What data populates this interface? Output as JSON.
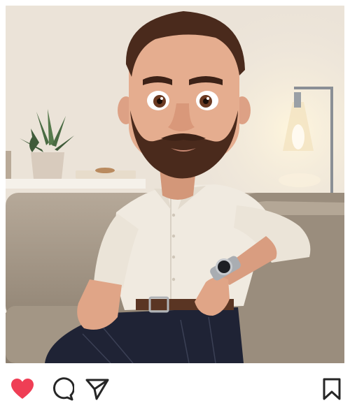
{
  "post": {
    "image": {
      "subject": "cartoon-man-on-sofa",
      "palette": {
        "wall": "#efe7dc",
        "sofa": "#a89b8c",
        "shirt": "#f1ece2",
        "hair": "#4a2a1c",
        "skin": "#e2a88a",
        "trousers": "#1e2233",
        "lamp_glow": "#fff3d2"
      }
    },
    "actions": {
      "like_icon": "heart-filled-icon",
      "comment_icon": "comment-bubble-icon",
      "share_icon": "send-paper-plane-icon",
      "save_icon": "bookmark-icon",
      "liked": true,
      "like_color": "#ef3e55",
      "icon_color": "#262626"
    }
  }
}
